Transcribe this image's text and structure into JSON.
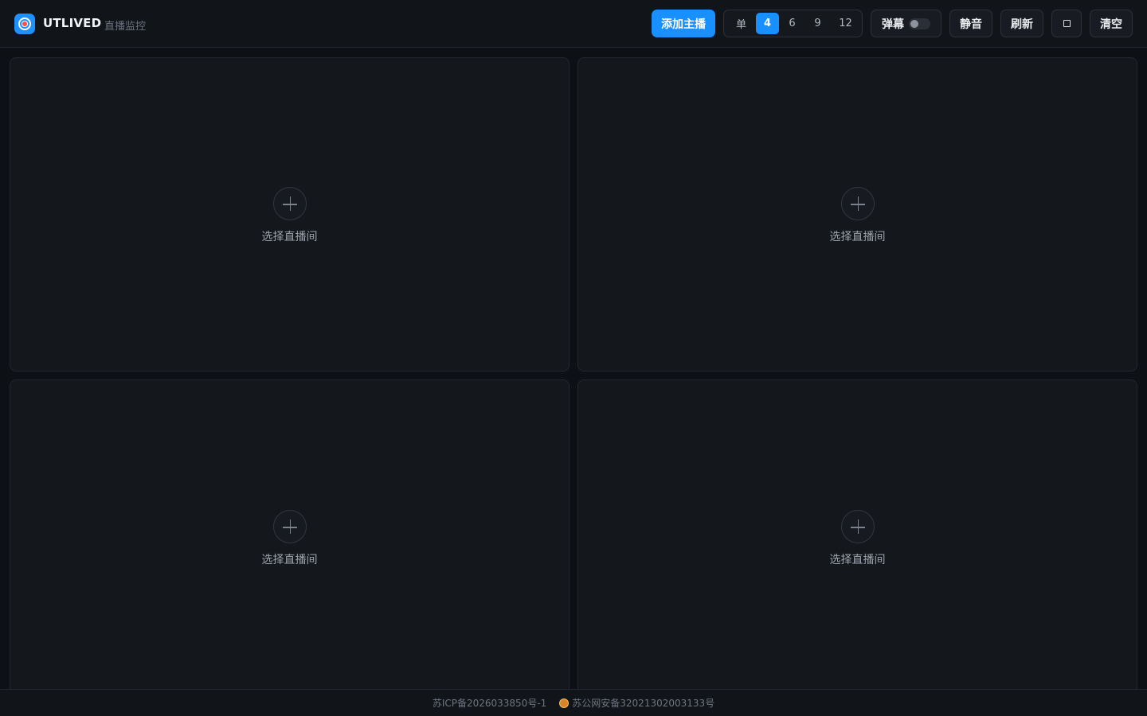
{
  "header": {
    "brand": "UTLIVED",
    "subtitle": "直播监控",
    "add_button": "添加主播",
    "layout_options": [
      "单",
      "4",
      "6",
      "9",
      "12"
    ],
    "layout_selected": "4",
    "danmaku_label": "弹幕",
    "danmaku_enabled": false,
    "mute_label": "静音",
    "refresh_label": "刷新",
    "clear_label": "清空"
  },
  "panels": [
    {
      "label": "选择直播间"
    },
    {
      "label": "选择直播间"
    },
    {
      "label": "选择直播间"
    },
    {
      "label": "选择直播间"
    }
  ],
  "footer": {
    "icp": "苏ICP备2026033850号-1",
    "police": "苏公网安备32021302003133号"
  },
  "colors": {
    "accent": "#1890ff",
    "background": "#0d1014",
    "panel": "#14171c"
  },
  "icons": {
    "logo": "radio-target-icon",
    "add": "plus-icon",
    "fullscreen": "square-icon",
    "police_badge": "badge-icon"
  }
}
